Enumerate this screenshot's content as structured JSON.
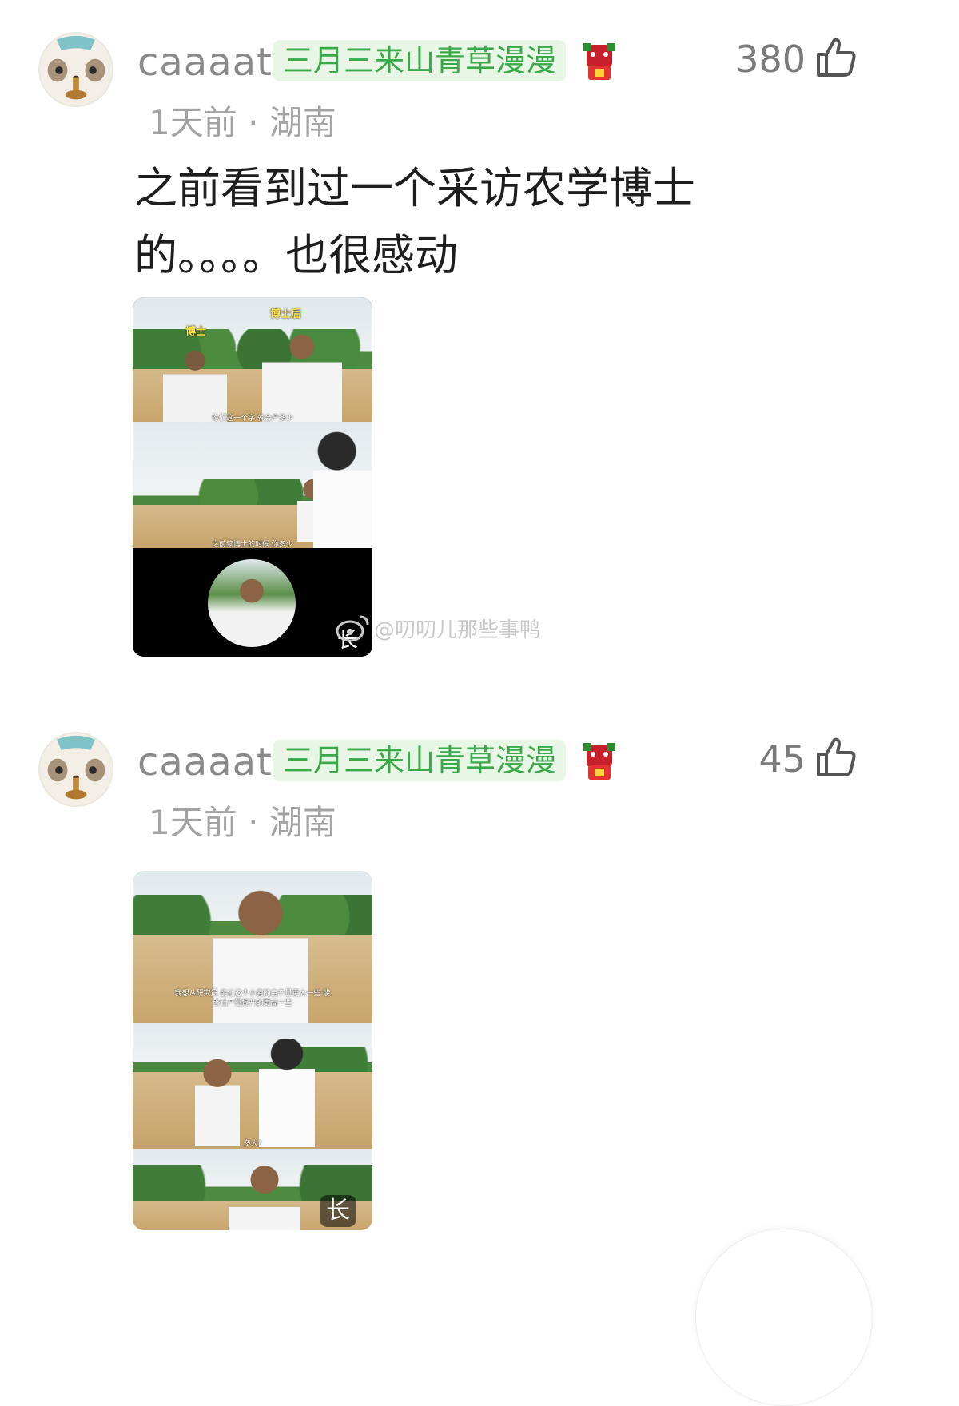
{
  "comments": [
    {
      "username": "caaaat",
      "badge": "三月三来山青草漫漫",
      "likes": "380",
      "meta": "1天前 · 湖南",
      "text_lines": [
        "之前看到过一个采访农学博士",
        "的。。。。也很感动"
      ],
      "image": {
        "labels": [
          "博士",
          "博士后"
        ],
        "captions": [
          "你们这一个字 就会产多少",
          "之前读博士的时候 你多少"
        ],
        "long_label": "长",
        "watermark": "@叨叨儿那些事鸭"
      }
    },
    {
      "username": "caaaat",
      "badge": "三月三来山青草漫漫",
      "likes": "45",
      "meta": "1天前 · 湖南",
      "text_lines": [],
      "image": {
        "captions": [
          "我想从研究员 能让这个小麦的亩产量更大一些 能够让产量提升的更高一些",
          "多大?"
        ],
        "long_label": "长"
      }
    }
  ],
  "colors": {
    "badge_bg": "#e8f6e6",
    "badge_text": "#3aa94a",
    "username": "#8a8a8a",
    "meta": "#a3a3a3"
  },
  "icons": {
    "thumb": "thumbs-up-icon",
    "medal": "medal-icon",
    "weibo": "weibo-icon"
  }
}
